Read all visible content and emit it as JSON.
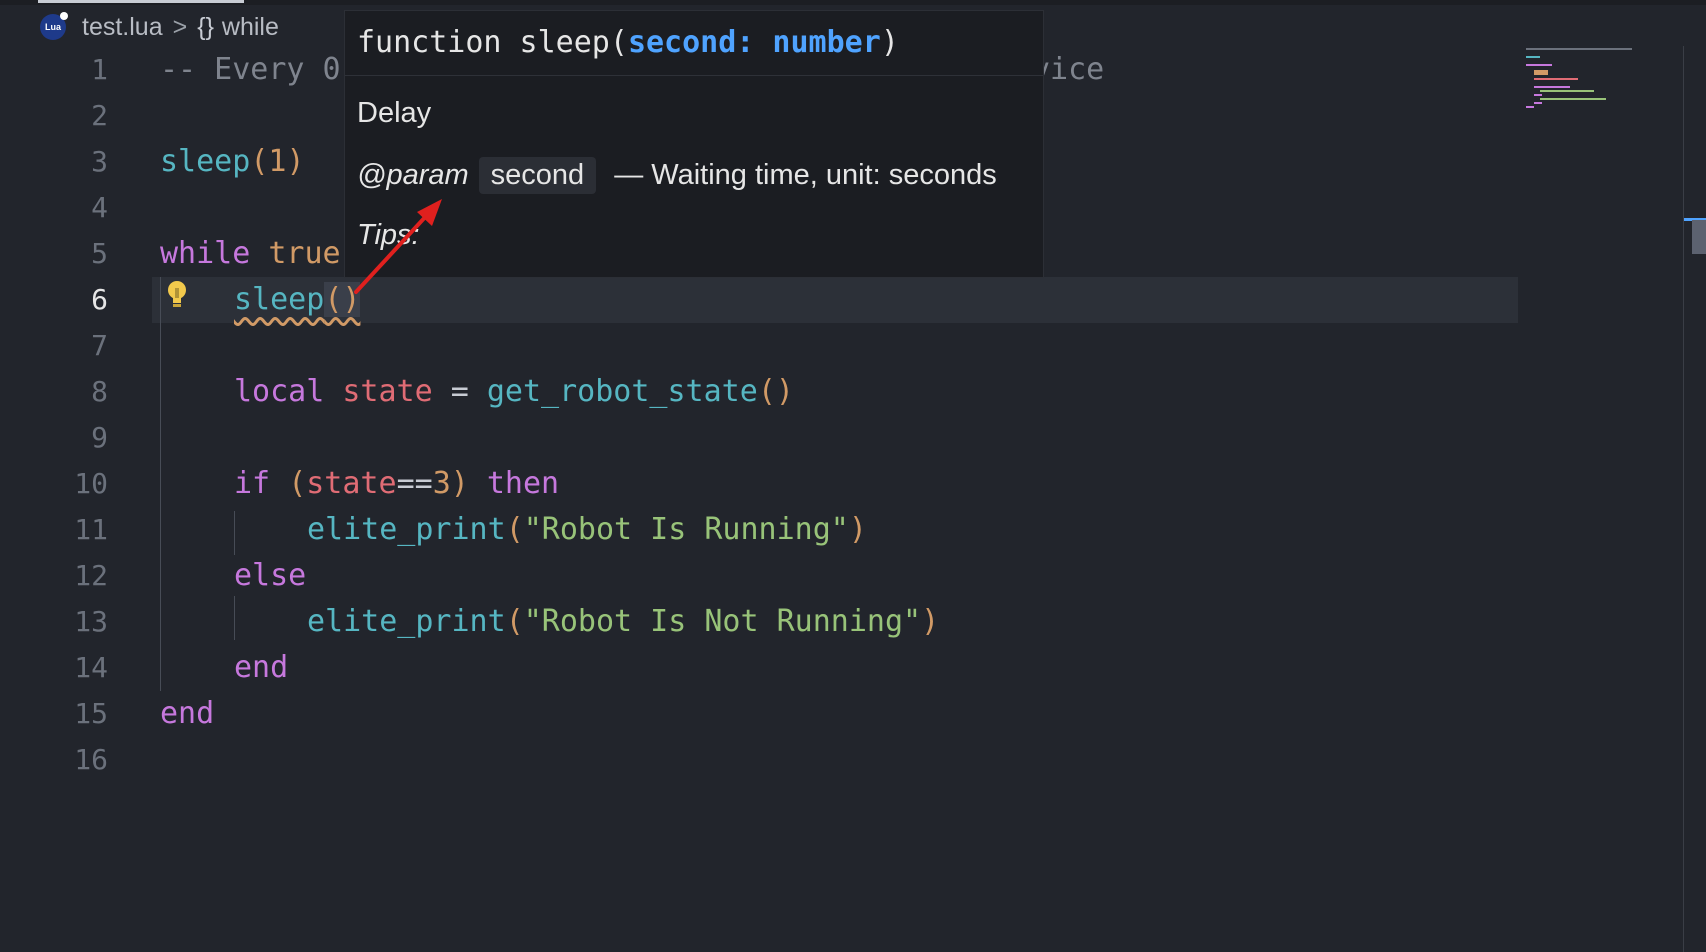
{
  "breadcrumb": {
    "file_icon": "lua-icon",
    "file_icon_text": "Lua",
    "file": "test.lua",
    "separator": ">",
    "symbol_icon": "{}",
    "symbol": "while"
  },
  "gutter": [
    "1",
    "2",
    "3",
    "4",
    "5",
    "6",
    "7",
    "8",
    "9",
    "10",
    "11",
    "12",
    "13",
    "14",
    "15",
    "16"
  ],
  "code": {
    "l1": {
      "dash": "--",
      "text": " Every 0",
      "tail": "vice"
    },
    "l3": {
      "fn": "sleep",
      "open": "(",
      "arg": "1",
      "close": ")"
    },
    "l5": {
      "kw": "while",
      "val": "true"
    },
    "l6": {
      "fn": "sleep",
      "parens": "()"
    },
    "l8": {
      "kw": "local",
      "var": "state",
      "eq": " = ",
      "fn": "get_robot_state",
      "parens": "()"
    },
    "l10": {
      "kw": "if",
      "open": "(",
      "var": "state",
      "op": "==",
      "num": "3",
      "close": ")",
      "then": "then"
    },
    "l11": {
      "fn": "elite_print",
      "open": "(",
      "str": "\"Robot Is Running\"",
      "close": ")"
    },
    "l12": {
      "kw": "else"
    },
    "l13": {
      "fn": "elite_print",
      "open": "(",
      "str": "\"Robot Is Not Running\"",
      "close": ")"
    },
    "l14": {
      "kw": "end"
    },
    "l15": {
      "kw": "end"
    }
  },
  "hover": {
    "signature_prefix": "function sleep(",
    "signature_param": "second: number",
    "signature_suffix": ")",
    "description": "Delay",
    "param_tag": "@param",
    "param_name": "second",
    "param_desc": " — Waiting time, unit: seconds",
    "tips": "Tips:"
  },
  "colors": {
    "background": "#22252c",
    "keyword": "#c678dd",
    "function": "#56b6c2",
    "string": "#98c379",
    "number": "#d19a66",
    "variable": "#e06c75",
    "param_highlight": "#4fa3ff",
    "annotation_arrow": "#e0201e"
  }
}
